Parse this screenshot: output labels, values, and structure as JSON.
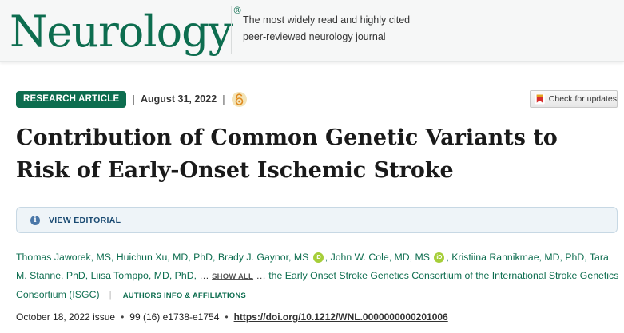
{
  "header": {
    "logo_text": "Neurology",
    "logo_registered": "®",
    "tagline_line1": "The most widely read and highly cited",
    "tagline_line2": "peer-reviewed neurology journal"
  },
  "meta": {
    "badge": "RESEARCH ARTICLE",
    "separator": "|",
    "date": "August 31, 2022",
    "open_access_icon": "open-access-lock-icon"
  },
  "check_updates": {
    "label": "Check for updates"
  },
  "article": {
    "title": "Contribution of Common Genetic Variants to Risk of Early-Onset Ischemic Stroke"
  },
  "editorial": {
    "label": "VIEW EDITORIAL"
  },
  "authors": {
    "part1": "Thomas Jaworek, MS, Huichun Xu, MD, PhD, Brady J. Gaynor, MS",
    "orcid_label": "iD",
    "part2": ", John W. Cole, MD, MS",
    "part3": ", Kristiina Rannikmae, MD, PhD, Tara M. Stanne, PhD, Liisa Tomppo, MD, PhD,",
    "ellipsis1": "…",
    "show_all": "SHOW ALL",
    "ellipsis2": "…",
    "consortium": "the Early Onset Stroke Genetics Consortium of the International Stroke Genetics Consortium (ISGC)",
    "separator": "|",
    "affiliations_link": "AUTHORS INFO & AFFILIATIONS"
  },
  "issue": {
    "date": "October 18, 2022 issue",
    "bullet": "•",
    "volume": "99 (16) e1738-e1754",
    "doi": "https://doi.org/10.1212/WNL.0000000000201006"
  },
  "colors": {
    "brand_green": "#0d6d4f",
    "editorial_bg": "#eef4f8",
    "orcid_green": "#a6ce39"
  }
}
